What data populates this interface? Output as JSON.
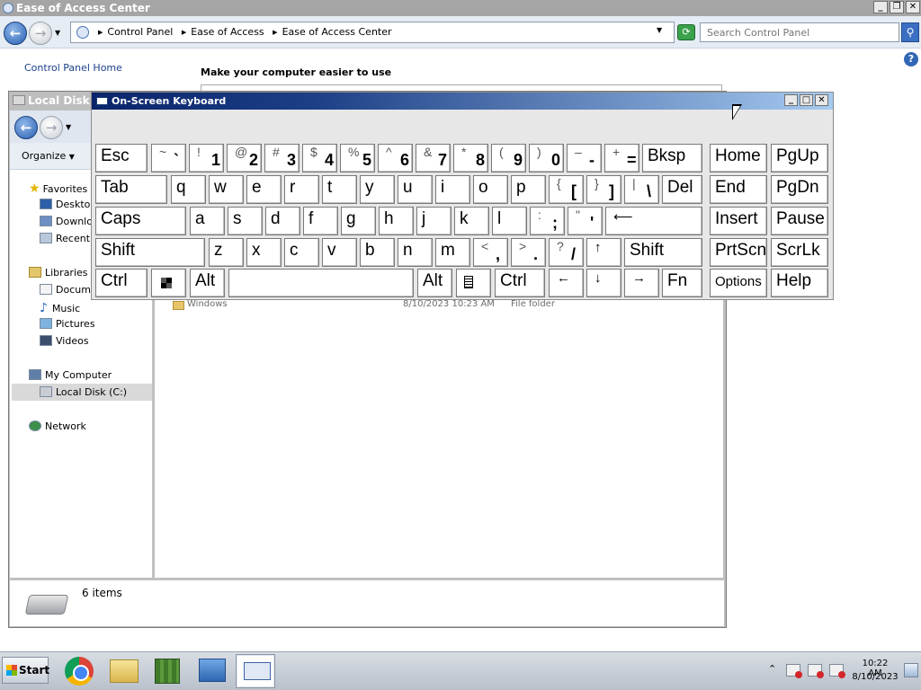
{
  "eoa_window": {
    "title": "Ease of Access Center",
    "breadcrumb": [
      "Control Panel",
      "Ease of Access",
      "Ease of Access Center"
    ],
    "search_placeholder": "Search Control Panel",
    "control_panel_home": "Control Panel Home",
    "heading": "Make your computer easier to use",
    "caption_buttons": [
      "_",
      "❐",
      "✕"
    ]
  },
  "explorer": {
    "title": "Local Disk (C:)",
    "organize": "Organize",
    "nav": {
      "favorites": "Favorites",
      "desktop": "Desktop",
      "downloads": "Downloads",
      "recent": "Recent Places",
      "libraries": "Libraries",
      "documents": "Documents",
      "music": "Music",
      "pictures": "Pictures",
      "videos": "Videos",
      "my_computer": "My Computer",
      "local_disk": "Local Disk (C:)",
      "network": "Network"
    },
    "file": {
      "name": "Windows",
      "date": "8/10/2023 10:23 AM",
      "type": "File folder"
    },
    "status": "6 items"
  },
  "osk": {
    "title": "On-Screen Keyboard",
    "caption_buttons": [
      "_",
      "□",
      "✕"
    ],
    "keys": {
      "esc": "Esc",
      "bksp": "Bksp",
      "home": "Home",
      "pgup": "PgUp",
      "tab": "Tab",
      "del": "Del",
      "end": "End",
      "pgdn": "PgDn",
      "caps": "Caps",
      "insert": "Insert",
      "pause": "Pause",
      "shift": "Shift",
      "prtscn": "PrtScn",
      "scrlk": "ScrLk",
      "ctrl": "Ctrl",
      "alt": "Alt",
      "fn": "Fn",
      "options": "Options",
      "help": "Help",
      "num": [
        {
          "s": "~",
          "m": "`"
        },
        {
          "s": "!",
          "m": "1"
        },
        {
          "s": "@",
          "m": "2"
        },
        {
          "s": "#",
          "m": "3"
        },
        {
          "s": "$",
          "m": "4"
        },
        {
          "s": "%",
          "m": "5"
        },
        {
          "s": "^",
          "m": "6"
        },
        {
          "s": "&",
          "m": "7"
        },
        {
          "s": "*",
          "m": "8"
        },
        {
          "s": "(",
          "m": "9"
        },
        {
          "s": ")",
          "m": "0"
        },
        {
          "s": "–",
          "m": "-"
        },
        {
          "s": "+",
          "m": "="
        }
      ],
      "row_q": [
        "q",
        "w",
        "e",
        "r",
        "t",
        "y",
        "u",
        "i",
        "o",
        "p"
      ],
      "brackets": [
        {
          "s": "{",
          "m": "["
        },
        {
          "s": "}",
          "m": "]"
        },
        {
          "s": "|",
          "m": "\\"
        }
      ],
      "row_a": [
        "a",
        "s",
        "d",
        "f",
        "g",
        "h",
        "j",
        "k",
        "l"
      ],
      "punct_a": [
        {
          "s": ":",
          "m": ";"
        },
        {
          "s": "\"",
          "m": "'"
        }
      ],
      "row_z": [
        "z",
        "x",
        "c",
        "v",
        "b",
        "n",
        "m"
      ],
      "punct_z": [
        {
          "s": "<",
          "m": ","
        },
        {
          "s": ">",
          "m": "."
        },
        {
          "s": "?",
          "m": "/"
        }
      ],
      "arrows": {
        "up": "↑",
        "left": "←",
        "down": "↓",
        "right": "→",
        "enter": "⟵"
      }
    }
  },
  "taskbar": {
    "start": "Start",
    "time": "10:22 AM",
    "date": "8/10/2023"
  }
}
